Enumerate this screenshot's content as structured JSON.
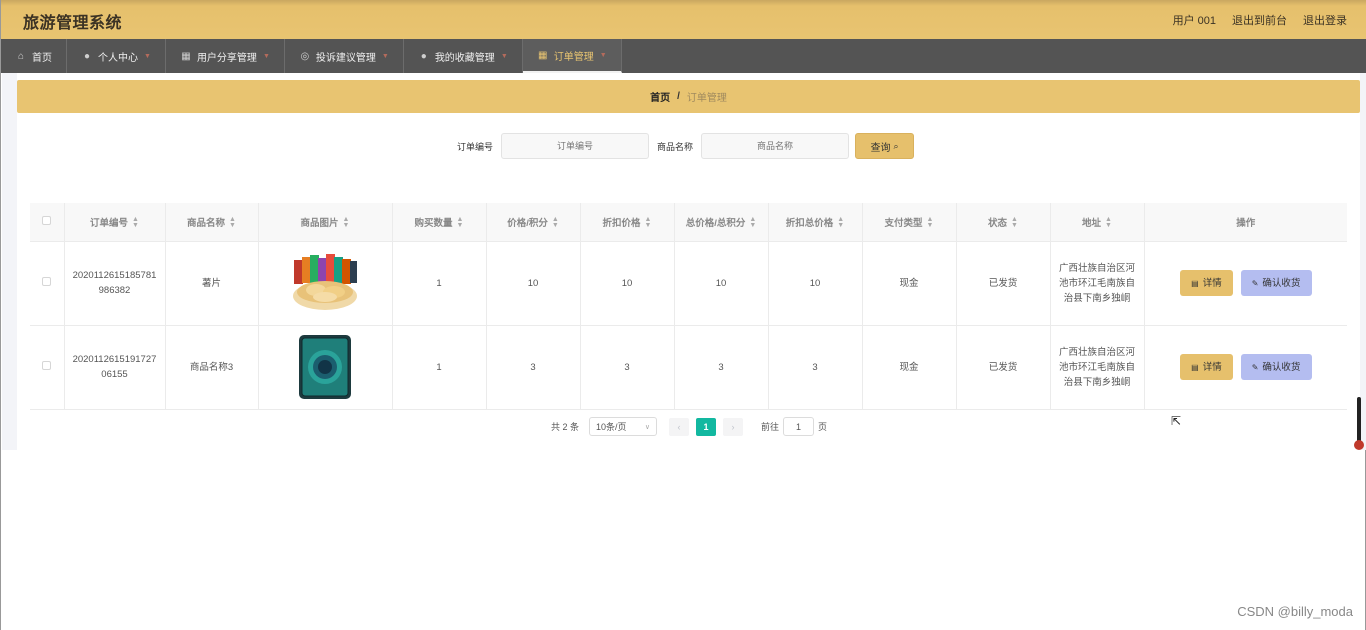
{
  "header": {
    "title": "旅游管理系统",
    "user": "用户 001",
    "front_link": "退出到前台",
    "logout_link": "退出登录"
  },
  "nav": {
    "items": [
      {
        "label": "首页",
        "icon": "home-icon"
      },
      {
        "label": "个人中心",
        "icon": "user-icon"
      },
      {
        "label": "用户分享管理",
        "icon": "grid-icon"
      },
      {
        "label": "投诉建议管理",
        "icon": "globe-icon"
      },
      {
        "label": "我的收藏管理",
        "icon": "user-icon"
      },
      {
        "label": "订单管理",
        "icon": "grid-icon"
      }
    ]
  },
  "breadcrumb": {
    "home": "首页",
    "separator": "/",
    "current": "订单管理"
  },
  "search": {
    "order_label": "订单编号",
    "order_placeholder": "订单编号",
    "product_label": "商品名称",
    "product_placeholder": "商品名称",
    "button": "查询"
  },
  "table": {
    "headers": [
      "订单编号",
      "商品名称",
      "商品图片",
      "购买数量",
      "价格/积分",
      "折扣价格",
      "总价格/总积分",
      "折扣总价格",
      "支付类型",
      "状态",
      "地址",
      "操作"
    ],
    "rows": [
      {
        "order_no": "2020112615185781986382",
        "product": "薯片",
        "image": "chips-image",
        "qty": "1",
        "price": "10",
        "discount_price": "10",
        "total": "10",
        "discount_total": "10",
        "pay_type": "现金",
        "status": "已发货",
        "address": "广西壮族自治区河池市环江毛南族自治县下南乡独峒",
        "detail": "详情",
        "confirm": "确认收货"
      },
      {
        "order_no": "202011261519172706155",
        "product": "商品名称3",
        "image": "phone-image",
        "qty": "1",
        "price": "3",
        "discount_price": "3",
        "total": "3",
        "discount_total": "3",
        "pay_type": "现金",
        "status": "已发货",
        "address": "广西壮族自治区河池市环江毛南族自治县下南乡独峒",
        "detail": "详情",
        "confirm": "确认收货"
      }
    ]
  },
  "pagination": {
    "total": "共 2 条",
    "page_size": "10条/页",
    "current_page": "1",
    "goto_label": "前往",
    "goto_value": "1",
    "page_unit": "页"
  },
  "watermark": "CSDN @billy_moda",
  "colors": {
    "header": "#e8c471",
    "nav": "#545454",
    "accent": "#e6c06c",
    "confirm": "#b4bdf0",
    "pager_active": "#12b8a0"
  }
}
